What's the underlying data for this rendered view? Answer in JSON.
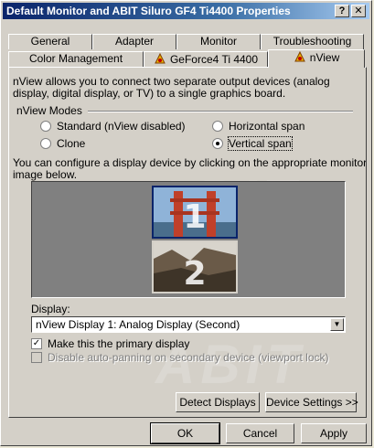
{
  "window": {
    "title": "Default Monitor and ABIT Siluro GF4 Ti4400 Properties",
    "help_button": "?",
    "close_button": "✕"
  },
  "tabs": {
    "row1": [
      {
        "label": "General"
      },
      {
        "label": "Adapter"
      },
      {
        "label": "Monitor"
      },
      {
        "label": "Troubleshooting"
      }
    ],
    "row2": [
      {
        "label": "Color Management"
      },
      {
        "label": "GeForce4 Ti 4400"
      },
      {
        "label": "nView",
        "active": true
      }
    ]
  },
  "panel": {
    "intro": "nView allows you to connect two separate output devices (analog",
    "intro2": "display, digital display, or TV) to a single graphics board.",
    "modes_heading": "nView Modes",
    "modes": {
      "standard": {
        "label": "Standard (nView disabled)",
        "selected": false
      },
      "horizontal": {
        "label": "Horizontal span",
        "selected": false
      },
      "clone": {
        "label": "Clone",
        "selected": false
      },
      "vertical": {
        "label": "Vertical span",
        "selected": true
      }
    },
    "config_text": "You can configure a display device by clicking on the appropriate monitor",
    "config_text2": "image below.",
    "displays": [
      {
        "number": "1",
        "selected": true
      },
      {
        "number": "2",
        "selected": false
      }
    ],
    "display_label": "Display:",
    "display_value": "nView Display 1: Analog Display  (Second)",
    "primary_checkbox": {
      "label": "Make this the primary display",
      "checked": true
    },
    "autopan_checkbox": {
      "label": "Disable auto-panning on secondary device (viewport lock)",
      "checked": false,
      "disabled": true
    },
    "detect_button": "Detect Displays",
    "device_settings_button": "Device Settings >>",
    "watermark": "ABIT"
  },
  "footer": {
    "ok": "OK",
    "cancel": "Cancel",
    "apply": "Apply"
  }
}
